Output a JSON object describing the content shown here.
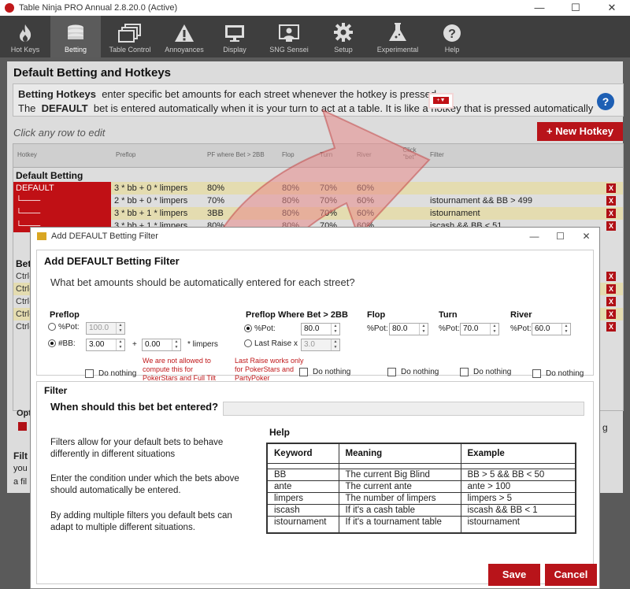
{
  "window": {
    "title": "Table Ninja PRO Annual 2.8.20.0 (Active)",
    "minimize": "—",
    "maximize": "☐",
    "close": "✕"
  },
  "ribbon": [
    {
      "label": "Hot Keys",
      "icon": "flame-icon"
    },
    {
      "label": "Betting",
      "icon": "chip-stack-icon"
    },
    {
      "label": "Table Control",
      "icon": "windows-icon"
    },
    {
      "label": "Annoyances",
      "icon": "warning-icon"
    },
    {
      "label": "Display",
      "icon": "monitor-icon"
    },
    {
      "label": "SNG Sensei",
      "icon": "sensei-icon"
    },
    {
      "label": "Setup",
      "icon": "gear-icon"
    },
    {
      "label": "Experimental",
      "icon": "flask-icon"
    },
    {
      "label": "Help",
      "icon": "question-icon"
    }
  ],
  "page": {
    "title": "Default Betting and Hotkeys",
    "hk_bold1": "Betting Hotkeys",
    "hk_text1": "enter specific bet amounts for each street whenever the hotkey is pressed.",
    "hk_pre2": "The",
    "hk_bold2": "DEFAULT",
    "hk_text2": "bet is entered automatically when it is your turn to act at a table. It is like a hotkey that is pressed automatically",
    "help_glyph": "?",
    "click_edit": "Click any row to edit",
    "new_hotkey": "+ New Hotkey"
  },
  "grid": {
    "headers": [
      "Hotkey",
      "Preflop",
      "PF where Bet > 2BB",
      "Flop",
      "Turn",
      "River",
      "Click \"bet\"",
      "Filter"
    ],
    "section1": "Default Betting",
    "section2": "Bett",
    "add_btn": "+▼",
    "delete": "X",
    "rows": [
      {
        "name": "DEFAULT",
        "preflop": "3 * bb + 0 * limpers",
        "pf2bb": "80%",
        "flop": "80%",
        "turn": "70%",
        "river": "60%",
        "filter": ""
      },
      {
        "name": "└───",
        "preflop": "2 * bb + 0 * limpers",
        "pf2bb": "70%",
        "flop": "80%",
        "turn": "70%",
        "river": "60%",
        "filter": "istournament && BB > 499"
      },
      {
        "name": "└───",
        "preflop": "3 * bb + 1 * limpers",
        "pf2bb": "3BB",
        "flop": "80%",
        "turn": "70%",
        "river": "60%",
        "filter": "istournament"
      },
      {
        "name": "└───",
        "preflop": "3 * bb + 1 * limpers",
        "pf2bb": "80%",
        "flop": "80%",
        "turn": "70%",
        "river": "60%",
        "filter": "iscash && BB < 51"
      }
    ],
    "hotkeys": [
      "Ctrl-",
      "Ctrl-",
      "Ctrl-",
      "Ctrl-",
      "Ctrl-"
    ],
    "cut1": "Opt",
    "cut2": "Filt",
    "cut3": "you",
    "cut4": "a fil",
    "cut5": "g"
  },
  "dialog": {
    "title": "Add DEFAULT Betting Filter",
    "heading": "Add DEFAULT Betting Filter",
    "question": "What bet amounts should be automatically entered for each street?",
    "preflop": {
      "label": "Preflop",
      "pot_label": "%Pot:",
      "pot_value": "100.0",
      "bb_label": "#BB:",
      "bb_value": "3.00",
      "plus": "+",
      "limp_value": "0.00",
      "limp_label": "* limpers",
      "nothing": "Do nothing",
      "warn": "We are not allowed to compute this for PokerStars and Full Tilt"
    },
    "pf2bb": {
      "label": "Preflop Where Bet > 2BB",
      "pot_label": "%Pot:",
      "pot_value": "80.0",
      "raise_label": "Last Raise x",
      "raise_value": "3.0",
      "nothing": "Do nothing",
      "warn": "Last Raise works only for PokerStars and PartyPoker"
    },
    "flop": {
      "label": "Flop",
      "pot_label": "%Pot:",
      "value": "80.0",
      "nothing": "Do nothing"
    },
    "turn": {
      "label": "Turn",
      "pot_label": "%Pot:",
      "value": "70.0",
      "nothing": "Do nothing"
    },
    "river": {
      "label": "River",
      "pot_label": "%Pot:",
      "value": "60.0",
      "nothing": "Do nothing"
    },
    "filter_label": "Filter",
    "filter_question": "When should this bet bet entered?",
    "filter_value": "",
    "para1": "Filters allow for your default bets to behave differently in different situations",
    "para2": "Enter the condition under which the bets above should automatically be entered.",
    "para3": "By adding multiple filters you default bets can adapt to multiple different situations.",
    "help_title": "Help",
    "help_cols": [
      "Keyword",
      "Meaning",
      "Example"
    ],
    "help_rows": [
      {
        "k": "BB",
        "m": "The current Big Blind",
        "e": "BB > 5 && BB < 50"
      },
      {
        "k": "ante",
        "m": "The current ante",
        "e": "ante > 100"
      },
      {
        "k": "limpers",
        "m": "The number of limpers",
        "e": "limpers > 5"
      },
      {
        "k": "iscash",
        "m": "If it's a cash table",
        "e": "iscash && BB < 1"
      },
      {
        "k": "istournament",
        "m": "If it's a tournament table",
        "e": "istournament"
      }
    ],
    "save": "Save",
    "cancel": "Cancel",
    "minimize": "—",
    "maximize": "☐",
    "close": "✕"
  }
}
